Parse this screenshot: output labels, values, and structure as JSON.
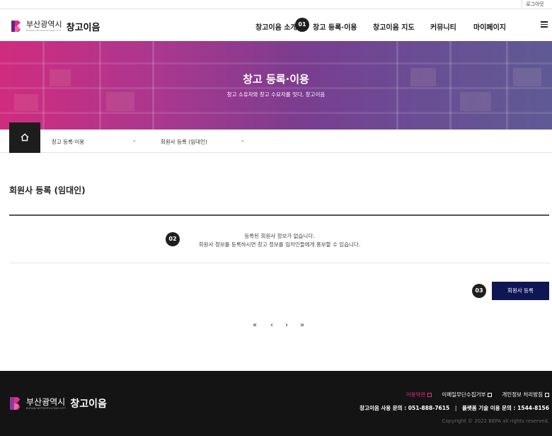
{
  "util": {
    "logout_label": "로그아웃"
  },
  "header": {
    "logo_city": "부산광역시",
    "logo_en": "BUSAN METROPOLITAN CITY",
    "logo_name": "창고이음",
    "nav": [
      "창고이음 소개",
      "창고 등록·이용",
      "창고이음 지도",
      "커뮤니티",
      "마이페이지"
    ]
  },
  "markers": {
    "m1": "01",
    "m2": "02",
    "m3": "03"
  },
  "hero": {
    "title": "창고 등록·이용",
    "subtitle": "창고 소유자와 창고 수요자를 잇다, 창고이음"
  },
  "location": {
    "select1": "창고 등록·이용",
    "select2": "회원사 등록 (임대인)"
  },
  "section": {
    "title": "회원사 등록 (임대인)",
    "empty_line1": "등록된 회원사 정보가 없습니다.",
    "empty_line2": "회원사 정보를 등록하시면 창고 정보를 임차인들에게 홍보할 수 있습니다.",
    "register_button": "회원사 등록"
  },
  "pagination": {
    "first": "«",
    "prev": "‹",
    "next": "›",
    "last": "»"
  },
  "footer": {
    "logo_city": "부산광역시",
    "logo_en": "BUSAN METROPOLITAN CITY",
    "logo_name": "창고이음",
    "links": [
      "이용약관",
      "이메일무단수집거부",
      "개인정보 처리방침"
    ],
    "contact1": "창고이음 사용 문의 : 051-888-7615",
    "contact_sep": "|",
    "contact2": "플랫폼 기술 이용 문의 : 1544-8156",
    "copyright": "Copyright © 2022 BEPA all rights reserved."
  },
  "colors": {
    "accent": "#e0308a",
    "navy_button": "#0f1654",
    "footer_bg": "#141414"
  },
  "icons": [
    "home-icon",
    "chevron-down-icon",
    "hamburger-icon",
    "external-link-icon"
  ]
}
